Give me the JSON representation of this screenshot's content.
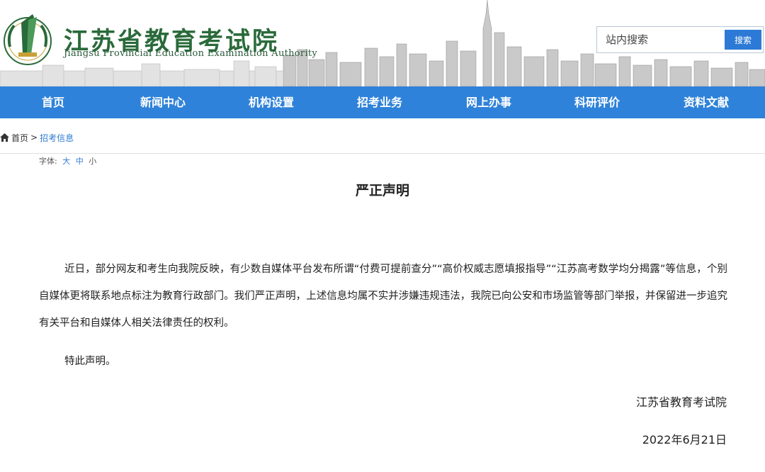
{
  "header": {
    "title_cn": "江苏省教育考试院",
    "title_en": "Jiangsu Provincial Education Examination Authority",
    "logo_icon": "jiangsu-exam-authority-logo-icon"
  },
  "search": {
    "placeholder": "站内搜索",
    "button_label": "搜索"
  },
  "nav": {
    "items": [
      {
        "label": "首页"
      },
      {
        "label": "新闻中心"
      },
      {
        "label": "机构设置"
      },
      {
        "label": "招考业务"
      },
      {
        "label": "网上办事"
      },
      {
        "label": "科研评价"
      },
      {
        "label": "资料文献"
      }
    ]
  },
  "breadcrumb": {
    "home": "首页",
    "separator": ">",
    "current": "招考信息"
  },
  "font_size": {
    "label": "字体:",
    "large": "大",
    "medium": "中",
    "small": "小"
  },
  "article": {
    "title": "严正声明",
    "paragraph1": "近日，部分网友和考生向我院反映，有少数自媒体平台发布所谓“付费可提前查分”“高价权威志愿填报指导”“江苏高考数学均分揭露”等信息，个别自媒体更将联系地点标注为教育行政部门。我们严正声明，上述信息均属不实并涉嫌违规违法，我院已向公安和市场监管等部门举报，并保留进一步追究有关平台和自媒体人相关法律责任的权利。",
    "paragraph2": "特此声明。",
    "signature_org": "江苏省教育考试院",
    "signature_date": "2022年6月21日"
  },
  "colors": {
    "nav_bg": "#2f82d9",
    "title_green": "#2a6a3a",
    "link_blue": "#2f7ad0",
    "search_button": "#2c7ad6"
  }
}
